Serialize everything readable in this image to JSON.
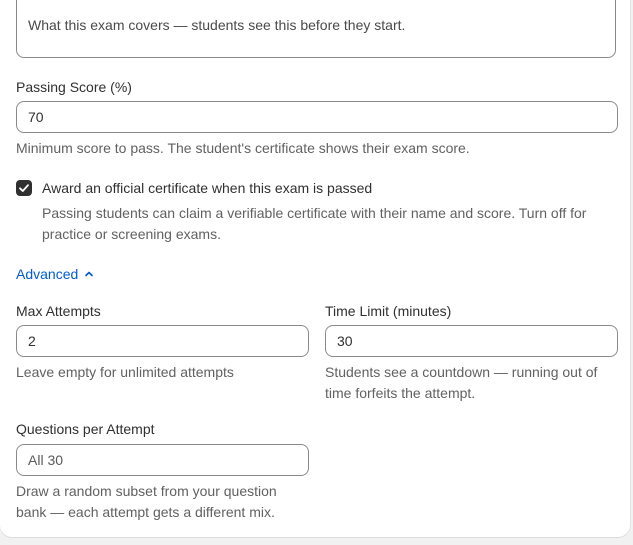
{
  "description": {
    "value": "What this exam covers — students see this before they start."
  },
  "passing_score": {
    "label": "Passing Score (%)",
    "value": "70",
    "help": "Minimum score to pass. The student's certificate shows their exam score."
  },
  "certificate": {
    "checked": true,
    "label": "Award an official certificate when this exam is passed",
    "help": "Passing students can claim a verifiable certificate with their name and score. Turn off for practice or screening exams."
  },
  "advanced": {
    "label": "Advanced",
    "icon": "chevron-up-icon",
    "accent": "#005bd3"
  },
  "max_attempts": {
    "label": "Max Attempts",
    "value": "2",
    "help": "Leave empty for unlimited attempts"
  },
  "time_limit": {
    "label": "Time Limit (minutes)",
    "value": "30",
    "help": "Students see a countdown — running out of time forfeits the attempt."
  },
  "questions_per_attempt": {
    "label": "Questions per Attempt",
    "value": "All 30",
    "help": "Draw a random subset from your question bank — each attempt gets a different mix."
  }
}
